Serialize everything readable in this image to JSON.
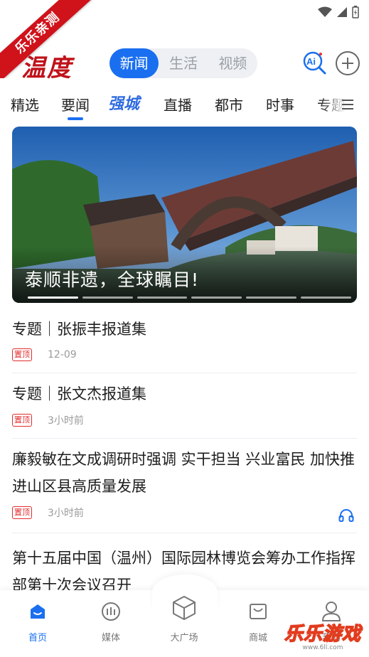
{
  "ribbon": {
    "text": "乐乐亲测"
  },
  "header": {
    "logo_text": "温度",
    "segments": [
      {
        "label": "新闻",
        "active": true
      },
      {
        "label": "生活",
        "active": false
      },
      {
        "label": "视频",
        "active": false
      }
    ],
    "ai_label": "Ai"
  },
  "tabs": [
    {
      "label": "精选"
    },
    {
      "label": "要闻",
      "active": true
    },
    {
      "label": "强城",
      "special": true
    },
    {
      "label": "直播"
    },
    {
      "label": "都市"
    },
    {
      "label": "时事"
    },
    {
      "label": "专题"
    }
  ],
  "banner": {
    "caption": "泰顺非遗，全球瞩目!",
    "slides": 6,
    "active_slide": 1
  },
  "news": [
    {
      "title": "专题｜张振丰报道集",
      "pin": "置顶",
      "time": "12-09",
      "audio": false
    },
    {
      "title": "专题｜张文杰报道集",
      "pin": "置顶",
      "time": "3小时前",
      "audio": false
    },
    {
      "title": "廉毅敏在文成调研时强调 实干担当 兴业富民 加快推进山区县高质量发展",
      "pin": "置顶",
      "time": "3小时前",
      "audio": true
    },
    {
      "title": "第十五届中国（温州）国际园林博览会筹办工作指挥部第十次会议召开",
      "pin": "",
      "time": "",
      "audio": false
    }
  ],
  "bottom_nav": [
    {
      "label": "首页",
      "icon": "home-icon",
      "active": true
    },
    {
      "label": "媒体",
      "icon": "media-icon"
    },
    {
      "label": "大广场",
      "icon": "cube-icon"
    },
    {
      "label": "商城",
      "icon": "mall-icon"
    },
    {
      "label": "我的",
      "icon": "profile-icon"
    }
  ],
  "watermark": {
    "text": "乐乐游戏",
    "url": "www.6ll.com"
  },
  "colors": {
    "accent": "#1a6ff0",
    "brand_red": "#c0121a",
    "pin_red": "#e32b2b"
  }
}
